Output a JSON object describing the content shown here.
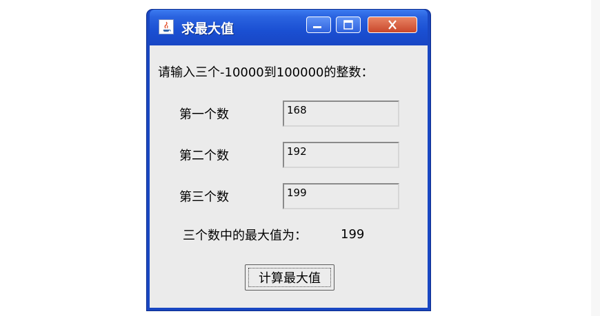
{
  "window": {
    "title": "求最大值",
    "app_icon": "java-coffee-cup-icon"
  },
  "titlebar_buttons": {
    "minimize": "minimize-icon",
    "maximize": "maximize-icon",
    "close": "close-icon"
  },
  "form": {
    "prompt": "请输入三个-10000到100000的整数：",
    "fields": [
      {
        "label": "第一个数",
        "value": "168"
      },
      {
        "label": "第二个数",
        "value": "192"
      },
      {
        "label": "第三个数",
        "value": "199"
      }
    ],
    "result_label": "三个数中的最大值为：",
    "result_value": "199",
    "compute_button": "计算最大值"
  },
  "colors": {
    "titlebar_blue": "#1a4fd2",
    "close_red": "#c9472b",
    "client_bg": "#ebebeb"
  }
}
